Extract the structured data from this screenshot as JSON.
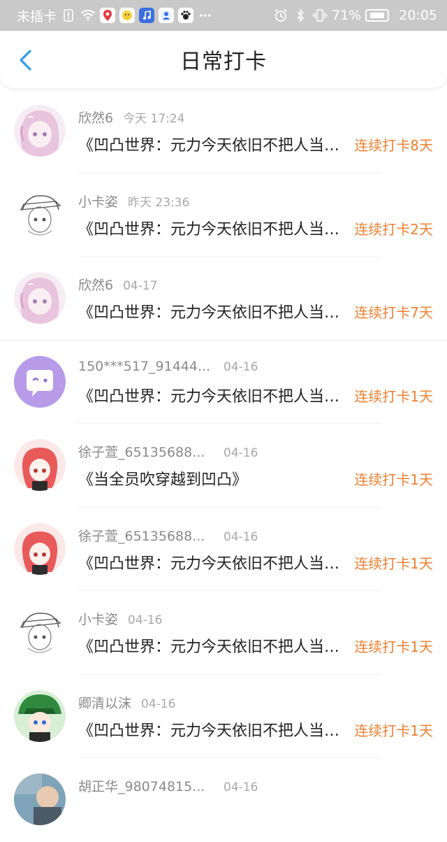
{
  "status_bar": {
    "carrier": "未插卡",
    "battery_percent": "71%",
    "time": "20:05"
  },
  "header": {
    "title": "日常打卡",
    "back_icon": "chevron-left-icon"
  },
  "colors": {
    "streak": "#f07f2f",
    "back_arrow": "#2f9be8"
  },
  "items": [
    {
      "name": "欣然6",
      "time": "今天 17:24",
      "content": "《凹凸世界：元力今天依旧不把人当人看",
      "streak": "连续打卡8天",
      "avatar": "pink-anime-girl"
    },
    {
      "name": "小卡姿",
      "time": "昨天 23:36",
      "content": "《凹凸世界：元力今天依旧不把人当人看",
      "streak": "连续打卡2天",
      "avatar": "sketch-anime-boy"
    },
    {
      "name": "欣然6",
      "time": "04-17",
      "content": "《凹凸世界：元力今天依旧不把人当人看",
      "streak": "连续打卡7天",
      "avatar": "pink-anime-girl"
    },
    {
      "name": "150***517_91444...",
      "time": "04-16",
      "content": "《凹凸世界：元力今天依旧不把人当人看",
      "streak": "连续打卡1天",
      "avatar": "purple-chat-bubble"
    },
    {
      "name": "徐子萱_65135688...",
      "time": "04-16",
      "content": "《当全员吹穿越到凹凸》",
      "streak": "连续打卡1天",
      "avatar": "red-hair-girl"
    },
    {
      "name": "徐子萱_65135688...",
      "time": "04-16",
      "content": "《凹凸世界：元力今天依旧不把人当人看",
      "streak": "连续打卡1天",
      "avatar": "red-hair-girl"
    },
    {
      "name": "小卡姿",
      "time": "04-16",
      "content": "《凹凸世界：元力今天依旧不把人当人看",
      "streak": "连续打卡1天",
      "avatar": "sketch-anime-boy"
    },
    {
      "name": "卿清以沫",
      "time": "04-16",
      "content": "《凹凸世界：元力今天依旧不把人当人看",
      "streak": "连续打卡1天",
      "avatar": "green-hat-boy"
    },
    {
      "name": "胡正华_98074815...",
      "time": "04-16",
      "content": "",
      "streak": "",
      "avatar": "photo-person"
    }
  ]
}
